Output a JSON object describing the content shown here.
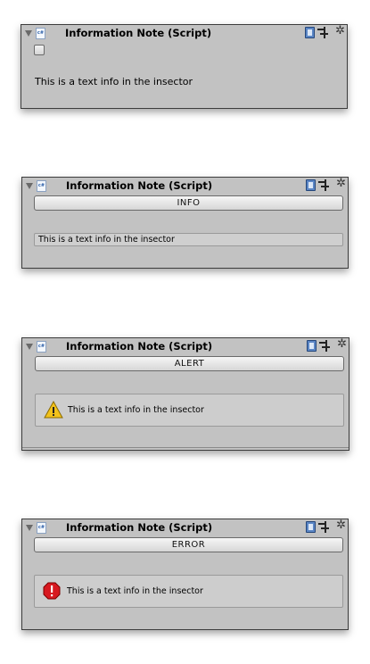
{
  "component_title": "Information Note (Script)",
  "script_icon_text": "c#",
  "gear_glyph": "✲",
  "panels": [
    {
      "style": "none",
      "message": "This is a text info in the insector"
    },
    {
      "style": "INFO",
      "message": "This is a text info in the insector"
    },
    {
      "style": "ALERT",
      "message": "This is a text info in the insector"
    },
    {
      "style": "ERROR",
      "message": "This is a text info in the insector"
    }
  ],
  "colors": {
    "panel_bg": "#c2c2c2",
    "warning": "#f2c21b",
    "error": "#d71920"
  }
}
